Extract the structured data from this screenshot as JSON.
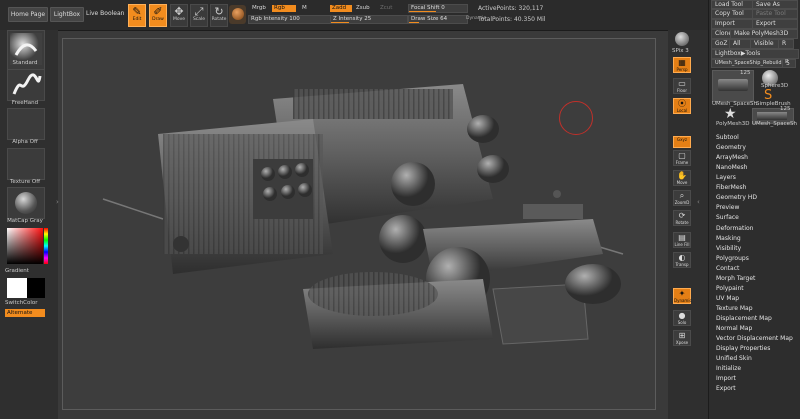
{
  "topbar": {
    "home_page": "Home Page",
    "lightbox": "LightBox",
    "live_boolean": "Live Boolean",
    "tools": [
      {
        "label": "Edit",
        "icon": "edit-icon",
        "active": true
      },
      {
        "label": "Draw",
        "icon": "draw-icon",
        "active": true
      },
      {
        "label": "Move",
        "icon": "move-icon",
        "active": false
      },
      {
        "label": "Scale",
        "icon": "scale-icon",
        "active": false
      },
      {
        "label": "Rotate",
        "icon": "rotate-icon",
        "active": false
      }
    ],
    "mrgb": "Mrgb",
    "rgb": "Rgb",
    "m": "M",
    "zadd": "Zadd",
    "zsub": "Zsub",
    "zcut": "Zcut",
    "rgb_intensity_label": "Rgb Intensity",
    "rgb_intensity": "100",
    "z_intensity_label": "Z Intensity",
    "z_intensity": "25",
    "focal_shift_label": "Focal Shift",
    "focal_shift": "0",
    "draw_size_label": "Draw Size",
    "draw_size": "64",
    "dynamic": "Dynamic",
    "active_points_label": "ActivePoints:",
    "active_points": "320,117",
    "total_points_label": "TotalPoints:",
    "total_points": "40.350 Mil"
  },
  "leftshelf": {
    "brush_standard": "Standard",
    "stroke_freehand": "FreeHand",
    "alpha": "Alpha Off",
    "texture": "Texture Off",
    "material": "MatCap Gray",
    "gradient": "Gradient",
    "switch_color": "SwitchColor",
    "alternate": "Alternate"
  },
  "rstrip": {
    "spix_label": "SPix",
    "spix": "3",
    "buttons": [
      {
        "label": "Persp",
        "icon": "persp-icon",
        "active": true
      },
      {
        "label": "Floor",
        "icon": "floor-icon",
        "active": false
      },
      {
        "label": "Local",
        "icon": "local-icon",
        "active": true
      },
      {
        "label": "Gxyz",
        "icon": "axis-icon",
        "active": true
      },
      {
        "label": "Frame",
        "icon": "frame-icon",
        "active": false
      },
      {
        "label": "Move",
        "icon": "move-icon",
        "active": false
      },
      {
        "label": "ZoomD",
        "icon": "zoom-icon",
        "active": false
      },
      {
        "label": "Rotate",
        "icon": "rotate-icon",
        "active": false
      },
      {
        "label": "Line Fill",
        "icon": "line-fill-icon",
        "active": false
      },
      {
        "label": "Transp",
        "icon": "transp-icon",
        "active": false
      },
      {
        "label": "Dynamic",
        "icon": "dynamic-icon",
        "active": true
      },
      {
        "label": "Solo",
        "icon": "solo-icon",
        "active": false
      },
      {
        "label": "Xpose",
        "icon": "xpose-icon",
        "active": false
      }
    ]
  },
  "palette": {
    "load_tool": "Load Tool",
    "save_as": "Save As",
    "copy_tool": "Copy Tool",
    "paste_tool": "Paste Tool",
    "import": "Import",
    "export": "Export",
    "clone": "Clone",
    "make_polymesh": "Make PolyMesh3D",
    "goz": "GoZ",
    "all": "All",
    "visible": "Visible",
    "r": "R",
    "lightbox_tools": "Lightbox▶Tools",
    "current_tool": "UMesh_SpaceShip_Rebuild",
    "current_tool_count": "5",
    "thumb_count": "125",
    "thumbs": [
      {
        "name": "UMesh_SpaceSh",
        "count": "125"
      },
      {
        "name": "Sphere3D",
        "count": ""
      },
      {
        "name": "SimpleBrush",
        "count": ""
      },
      {
        "name": "PolyMesh3D",
        "count": ""
      },
      {
        "name": "UMesh_SpaceSh",
        "count": "125"
      }
    ],
    "menu": [
      "Subtool",
      "Geometry",
      "ArrayMesh",
      "NanoMesh",
      "Layers",
      "FiberMesh",
      "Geometry HD",
      "Preview",
      "Surface",
      "Deformation",
      "Masking",
      "Visibility",
      "Polygroups",
      "Contact",
      "Morph Target",
      "Polypaint",
      "UV Map",
      "Texture Map",
      "Displacement Map",
      "Normal Map",
      "Vector Displacement Map",
      "Display Properties",
      "Unified Skin",
      "Initialize",
      "Import",
      "Export"
    ]
  },
  "colors": {
    "accent": "#f28c1e",
    "cursor": "#c0302a"
  }
}
